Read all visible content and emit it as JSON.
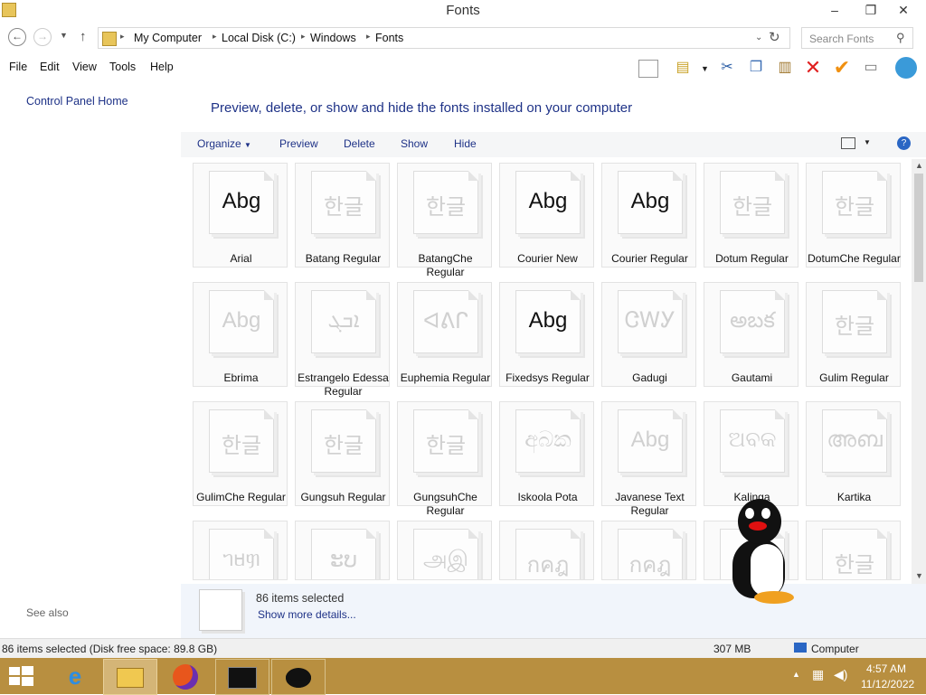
{
  "window": {
    "title": "Fonts"
  },
  "titlebar": {
    "minimize": "–",
    "maximize": "❐",
    "close": "✕"
  },
  "address": {
    "segments": [
      "My Computer",
      "Local Disk (C:)",
      "Windows",
      "Fonts"
    ],
    "search_placeholder": "Search Fonts"
  },
  "menu": [
    "File",
    "Edit",
    "View",
    "Tools",
    "Help"
  ],
  "left_pane": {
    "home": "Control Panel Home",
    "see_also": "See also"
  },
  "headline": "Preview, delete, or show and hide the fonts installed on your computer",
  "commands": {
    "organize": "Organize",
    "preview": "Preview",
    "delete": "Delete",
    "show": "Show",
    "hide": "Hide"
  },
  "fonts": [
    {
      "name": "Arial",
      "sample": "Abg",
      "active": true
    },
    {
      "name": "Batang Regular",
      "sample": "한글",
      "active": false
    },
    {
      "name": "BatangChe Regular",
      "sample": "한글",
      "active": false
    },
    {
      "name": "Courier New",
      "sample": "Abg",
      "active": true
    },
    {
      "name": "Courier Regular",
      "sample": "Abg",
      "active": true
    },
    {
      "name": "Dotum Regular",
      "sample": "한글",
      "active": false
    },
    {
      "name": "DotumChe Regular",
      "sample": "한글",
      "active": false
    },
    {
      "name": "Ebrima",
      "sample": "Abg",
      "active": false
    },
    {
      "name": "Estrangelo Edessa Regular",
      "sample": "ܐܒܓ",
      "active": false
    },
    {
      "name": "Euphemia Regular",
      "sample": "ᐊᕕᒋ",
      "active": false
    },
    {
      "name": "Fixedsys Regular",
      "sample": "Abg",
      "active": true
    },
    {
      "name": "Gadugi",
      "sample": "ᏣᎳᎩ",
      "active": false
    },
    {
      "name": "Gautami",
      "sample": "అబక",
      "active": false
    },
    {
      "name": "Gulim Regular",
      "sample": "한글",
      "active": false
    },
    {
      "name": "GulimChe Regular",
      "sample": "한글",
      "active": false
    },
    {
      "name": "Gungsuh Regular",
      "sample": "한글",
      "active": false
    },
    {
      "name": "GungsuhChe Regular",
      "sample": "한글",
      "active": false
    },
    {
      "name": "Iskoola Pota",
      "sample": "අබක",
      "active": false
    },
    {
      "name": "Javanese Text Regular",
      "sample": "Abg",
      "active": false
    },
    {
      "name": "Kalinga",
      "sample": "ଅବକ",
      "active": false
    },
    {
      "name": "Kartika",
      "sample": "അബ",
      "active": false
    },
    {
      "name": "",
      "sample": "ᥐᥛᥞ",
      "active": false
    },
    {
      "name": "",
      "sample": "ະບ",
      "active": false
    },
    {
      "name": "",
      "sample": "அஇ",
      "active": false
    },
    {
      "name": "",
      "sample": "กคฎ",
      "active": false
    },
    {
      "name": "",
      "sample": "กคฎ",
      "active": false
    },
    {
      "name": "",
      "sample": "",
      "active": false
    },
    {
      "name": "",
      "sample": "한글",
      "active": false
    }
  ],
  "details": {
    "count": "86 items selected",
    "more": "Show more details..."
  },
  "status": {
    "left": "86 items selected (Disk free space: 89.8 GB)",
    "size": "307 MB",
    "location": "Computer"
  },
  "clock": {
    "time": "4:57 AM",
    "date": "11/12/2022"
  }
}
